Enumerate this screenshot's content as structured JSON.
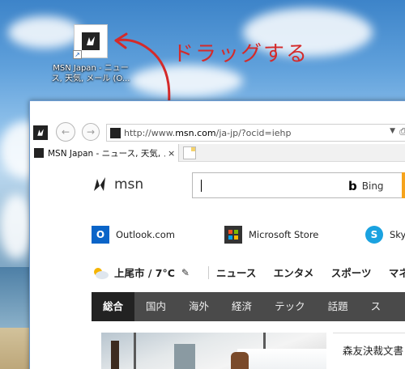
{
  "desktop_icon": {
    "label": "MSN Japan - ニュース, 天気, メール (O...",
    "icon": "msn-butterfly-icon"
  },
  "annotation": {
    "text": "ドラッグする",
    "color": "#d42a2a"
  },
  "browser": {
    "address": {
      "url_prefix": "http://www.",
      "url_host": "msn.com",
      "url_path": "/ja-jp/?ocid=iehp"
    },
    "tab": {
      "title": "MSN Japan - ニュース, 天気, メ...",
      "close": "×"
    }
  },
  "page": {
    "logo_text": "msn",
    "search": {
      "engine_label": "Bing",
      "accent": "#f6a31c"
    },
    "quick_links": [
      {
        "label": "Outlook.com",
        "icon": "outlook-icon",
        "color": "#0a64c8"
      },
      {
        "label": "Microsoft Store",
        "icon": "store-bag-icon",
        "color": "#333333"
      },
      {
        "label": "Skyp",
        "icon": "skype-icon",
        "color": "#1aa2e0"
      }
    ],
    "weather": {
      "text": "上尾市 / 7°C"
    },
    "nav_links": [
      "ニュース",
      "エンタメ",
      "スポーツ",
      "マネー"
    ],
    "categories": [
      "総合",
      "国内",
      "海外",
      "経済",
      "テック",
      "話題",
      "ス"
    ],
    "active_category": "総合",
    "headline": "森友決裁文書"
  }
}
